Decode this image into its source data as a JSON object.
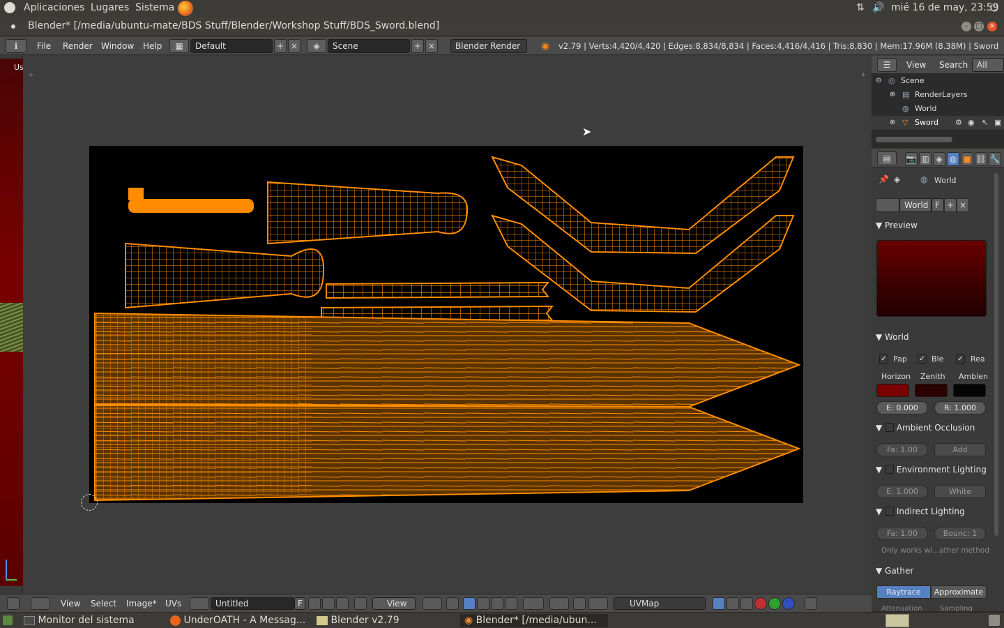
{
  "system_panel": {
    "menus": [
      "Aplicaciones",
      "Lugares",
      "Sistema"
    ],
    "clock": "mié 16 de may, 23:59"
  },
  "window": {
    "title": "Blender* [/media/ubuntu-mate/BDS Stuff/Blender/Workshop Stuff/BDS_Sword.blend]"
  },
  "info_header": {
    "menus": [
      "File",
      "Render",
      "Window",
      "Help"
    ],
    "layout": "Default",
    "scene": "Scene",
    "engine": "Blender Render",
    "stats": "v2.79 | Verts:4,420/4,420 | Edges:8,834/8,834 | Faces:4,416/4,416 | Tris:8,830 | Mem:17.96M (8.38M) | Sword"
  },
  "left_strip": {
    "label": "Us"
  },
  "outliner": {
    "header_menus": [
      "View",
      "Search",
      "All Scen"
    ],
    "items": [
      {
        "label": "Scene"
      },
      {
        "label": "RenderLayers"
      },
      {
        "label": "World"
      },
      {
        "label": "Sword"
      }
    ]
  },
  "properties": {
    "context": "World",
    "datablock": "World",
    "datablock_flag": "F",
    "panels": {
      "preview": "Preview",
      "world": "World",
      "ao": "Ambient Occlusion",
      "env": "Environment Lighting",
      "indirect": "Indirect Lighting",
      "gather": "Gather"
    },
    "world_checks": [
      "Pap",
      "Ble",
      "Rea"
    ],
    "color_labels": [
      "Horizon",
      "Zenith",
      "Ambien"
    ],
    "colors": {
      "horizon": "#7a0000",
      "zenith": "#2a0000",
      "ambient": "#050505"
    },
    "exposure": "E: 0.000",
    "range": "R: 1.000",
    "ao_factor": "Fa: 1.00",
    "ao_blend": "Add",
    "env_energy": "E: 1.000",
    "env_color": "White",
    "ind_factor": "Fa: 1.00",
    "ind_bounces": "Bounc: 1",
    "note": "Only works wi...ather method",
    "gather_tabs": [
      "Raytrace",
      "Approximate"
    ],
    "sub_labels": [
      "Attenuation",
      "Sampling"
    ]
  },
  "uv_header": {
    "menus": [
      "View",
      "Select",
      "Image*",
      "UVs"
    ],
    "image_name": "Untitled",
    "image_flag": "F",
    "view_mode": "View",
    "uvmap": "UVMap"
  },
  "taskbar": {
    "items": [
      "Monitor del sistema",
      "UnderOATH - A Messag...",
      "Blender v2.79",
      "Blender* [/media/ubun..."
    ]
  },
  "colors": {
    "accent": "#ff8c00",
    "uv_fill": "#5a3300",
    "preview_red": "#6a0000"
  }
}
